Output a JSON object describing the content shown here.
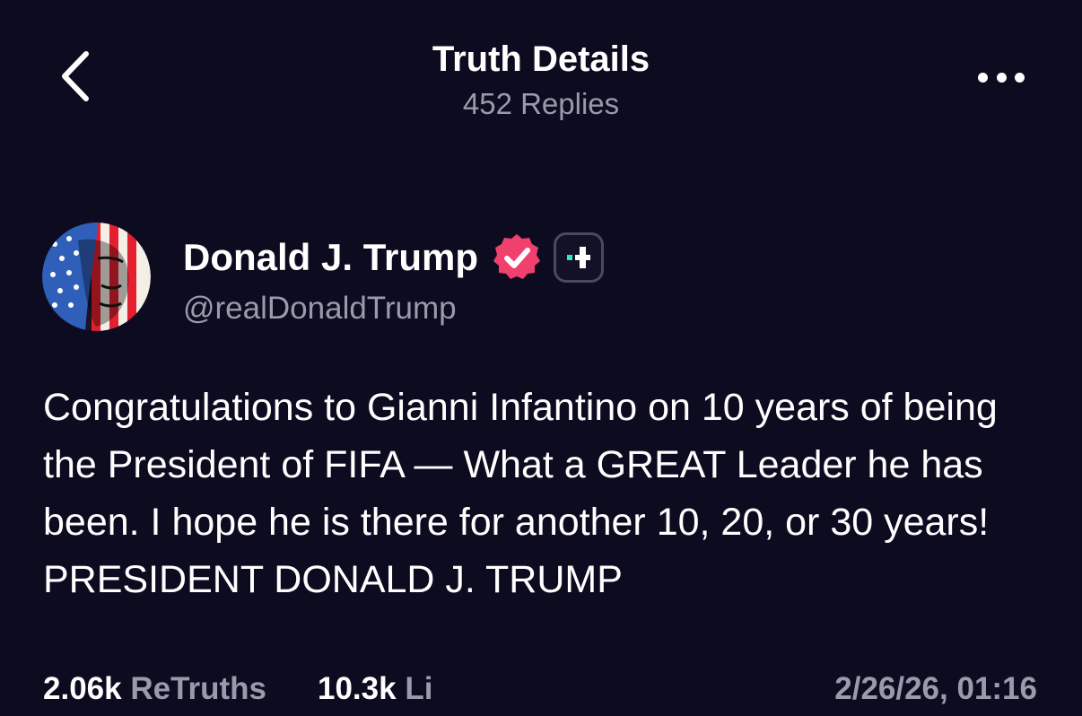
{
  "header": {
    "title": "Truth Details",
    "replies": "452 Replies",
    "back_icon": "chevron-left-icon",
    "more_icon": "more-horizontal-icon"
  },
  "author": {
    "name": "Donald J. Trump",
    "handle": "@realDonaldTrump",
    "verified_icon": "verified-badge-icon",
    "verified_color": "#f0406d",
    "plus_badge_icon": "truth-plus-icon",
    "plus_badge_color": "#2ee6c8"
  },
  "post": {
    "text": "Congratulations to Gianni Infantino on 10 years of being the President of FIFA — What a GREAT Leader he has been. I hope he is there for another 10, 20, or 30 years! PRESIDENT DONALD J. TRUMP"
  },
  "stats": {
    "retruths_count": "2.06k",
    "retruths_label": "ReTruths",
    "likes_count": "10.3k",
    "likes_label": "Li",
    "timestamp": "2/26/26, 01:16"
  },
  "colors": {
    "background": "#0d0b1f",
    "text_primary": "#ffffff",
    "text_secondary": "#9b99ac"
  }
}
